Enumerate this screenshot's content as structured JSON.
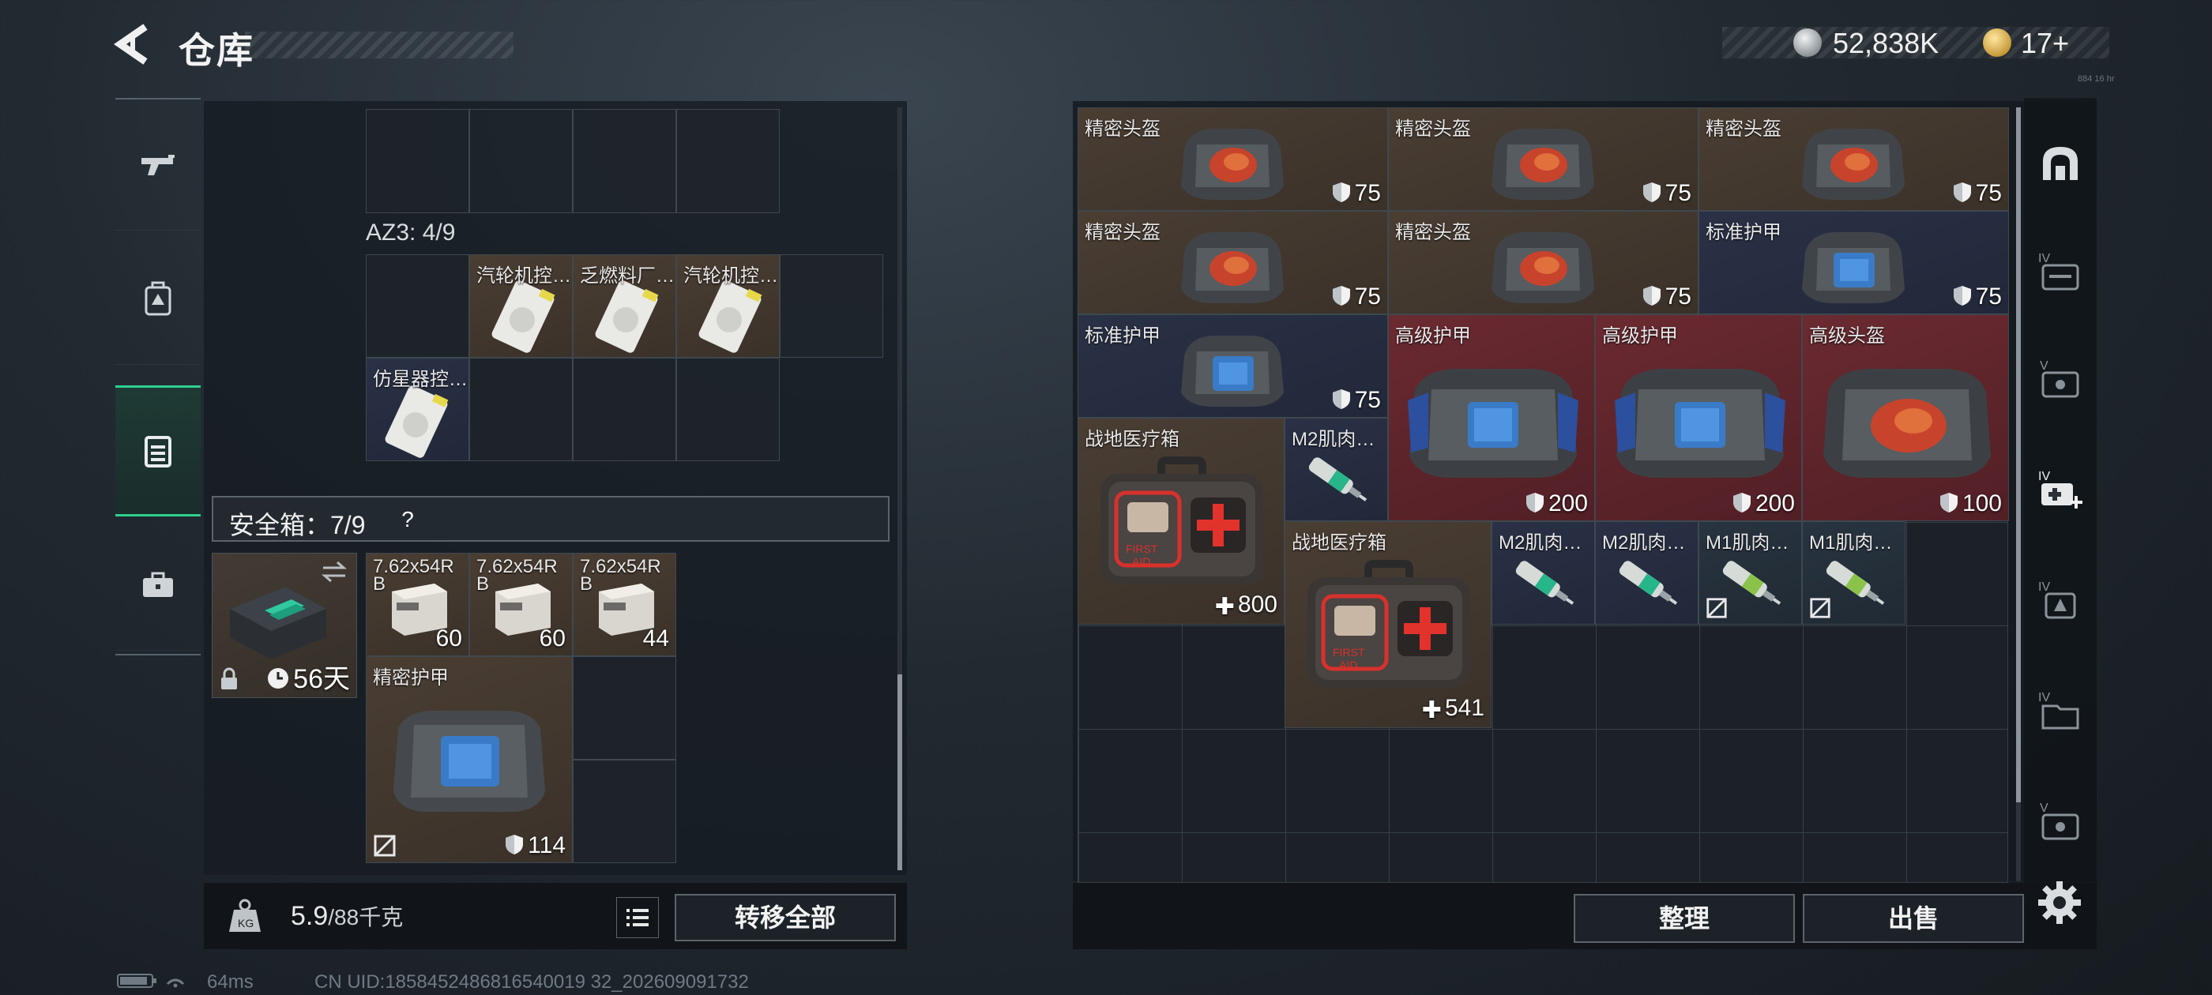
{
  "header": {
    "title": "仓库"
  },
  "currency": {
    "silver": "52,838K",
    "gold": "17+",
    "tiny": "884 16 hr"
  },
  "left_nav": [
    {
      "id": "weapons",
      "icon": "gun-icon"
    },
    {
      "id": "loadout",
      "icon": "backpack-icon"
    },
    {
      "id": "storage",
      "icon": "storage-box-icon",
      "active": true
    },
    {
      "id": "toolbox",
      "icon": "toolbox-icon"
    }
  ],
  "left_panel": {
    "az3_label": "AZ3: 4/9",
    "az3_items": [
      {
        "name": "汽轮机控…"
      },
      {
        "name": "乏燃料厂…"
      },
      {
        "name": "汽轮机控…"
      },
      {
        "name": "仿星器控…"
      }
    ],
    "safebox": {
      "label": "安全箱：7/9",
      "help": "?",
      "days": "56天"
    },
    "safebox_items": [
      {
        "name": "7.62x54R B",
        "value": "60"
      },
      {
        "name": "7.62x54R B",
        "value": "60"
      },
      {
        "name": "7.62x54R B",
        "value": "44"
      },
      {
        "name": "精密护甲",
        "value": "114"
      }
    ],
    "weight": {
      "current": "5.9",
      "max": "/88千克"
    },
    "transfer_all": "转移全部"
  },
  "right_panel": {
    "items": [
      {
        "name": "精密头盔",
        "value": "75"
      },
      {
        "name": "精密头盔",
        "value": "75"
      },
      {
        "name": "精密头盔",
        "value": "75"
      },
      {
        "name": "精密头盔",
        "value": "75"
      },
      {
        "name": "精密头盔",
        "value": "75"
      },
      {
        "name": "标准护甲",
        "value": "75"
      },
      {
        "name": "标准护甲",
        "value": "75"
      },
      {
        "name": "高级护甲",
        "value": "200"
      },
      {
        "name": "高级护甲",
        "value": "200"
      },
      {
        "name": "高级头盔",
        "value": "100"
      },
      {
        "name": "战地医疗箱",
        "value": "800"
      },
      {
        "name": "M2肌肉…"
      },
      {
        "name": "战地医疗箱",
        "value": "541"
      },
      {
        "name": "M2肌肉…"
      },
      {
        "name": "M2肌肉…"
      },
      {
        "name": "M1肌肉…"
      },
      {
        "name": "M1肌肉…"
      }
    ],
    "sort": "整理",
    "sell": "出售"
  },
  "colors": {
    "accent": "#2fcf91",
    "brown_tile": "#4a3e33",
    "navy_tile": "#2a3146",
    "red_tile": "#6a2a30"
  },
  "status": {
    "ping": "64ms",
    "uid": "CN UID:1858452486816540019 32_202609091732"
  }
}
